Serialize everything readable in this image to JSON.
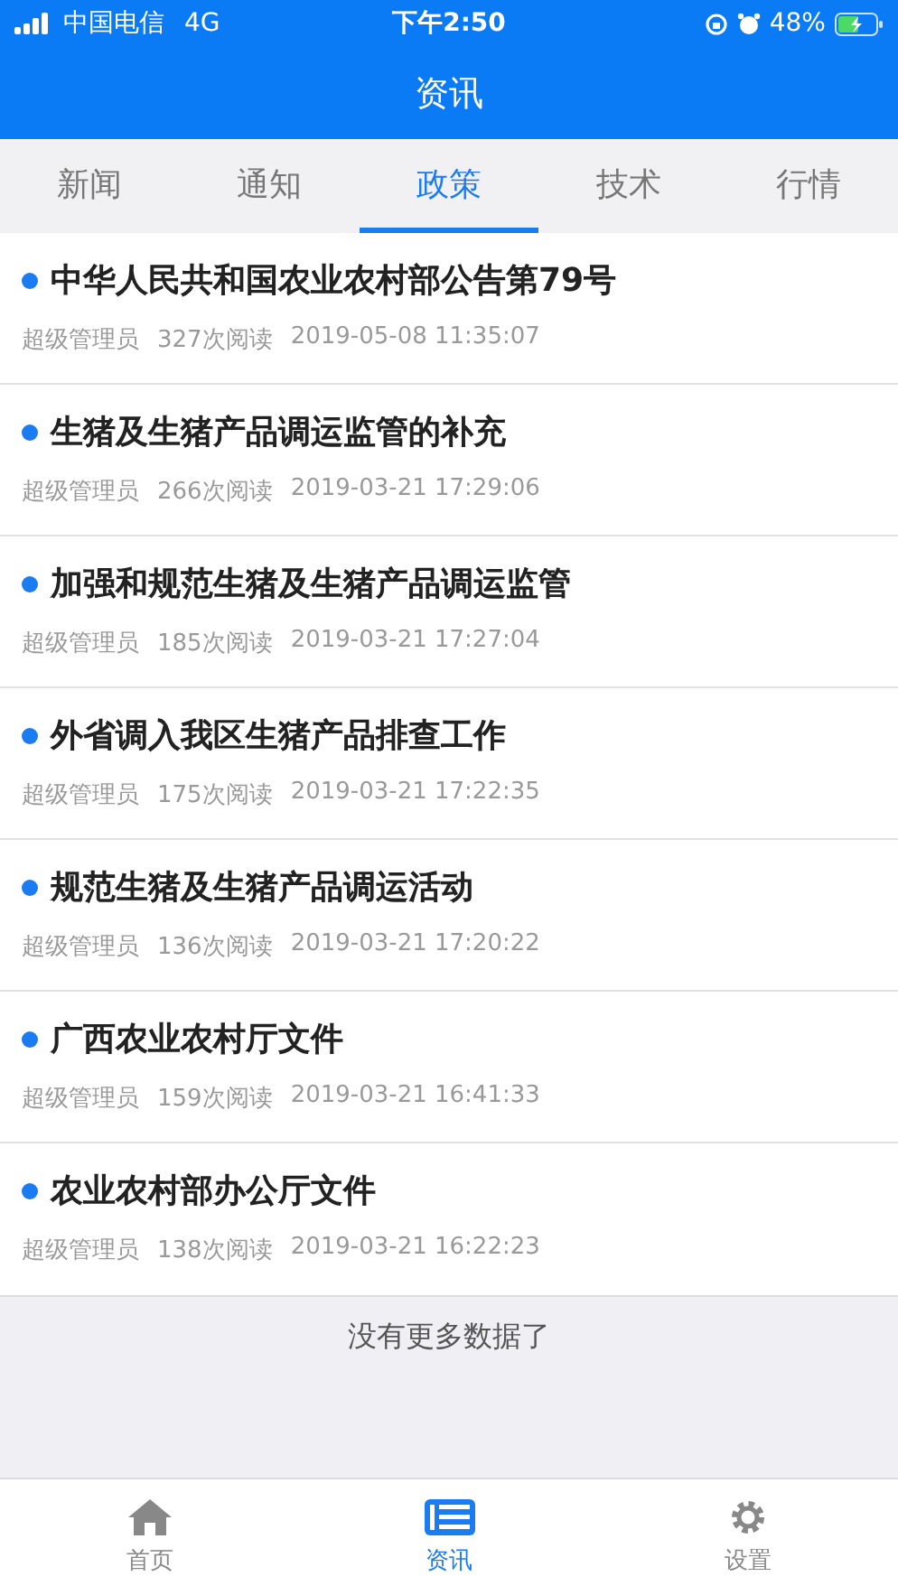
{
  "status_bar": {
    "carrier": "中国电信",
    "network": "4G",
    "time": "下午2:50",
    "battery": "48%"
  },
  "header": {
    "title": "资讯"
  },
  "tabs": [
    {
      "label": "新闻",
      "selected": false
    },
    {
      "label": "通知",
      "selected": false
    },
    {
      "label": "政策",
      "selected": true
    },
    {
      "label": "技术",
      "selected": false
    },
    {
      "label": "行情",
      "selected": false
    }
  ],
  "articles": [
    {
      "title": "中华人民共和国农业农村部公告第79号",
      "author": "超级管理员",
      "reads": "327次阅读",
      "date": "2019-05-08 11:35:07"
    },
    {
      "title": "生猪及生猪产品调运监管的补充",
      "author": "超级管理员",
      "reads": "266次阅读",
      "date": "2019-03-21 17:29:06"
    },
    {
      "title": "加强和规范生猪及生猪产品调运监管",
      "author": "超级管理员",
      "reads": "185次阅读",
      "date": "2019-03-21 17:27:04"
    },
    {
      "title": "外省调入我区生猪产品排查工作",
      "author": "超级管理员",
      "reads": "175次阅读",
      "date": "2019-03-21 17:22:35"
    },
    {
      "title": "规范生猪及生猪产品调运活动",
      "author": "超级管理员",
      "reads": "136次阅读",
      "date": "2019-03-21 17:20:22"
    },
    {
      "title": "广西农业农村厅文件",
      "author": "超级管理员",
      "reads": "159次阅读",
      "date": "2019-03-21 16:41:33"
    },
    {
      "title": "农业农村部办公厅文件",
      "author": "超级管理员",
      "reads": "138次阅读",
      "date": "2019-03-21 16:22:23"
    }
  ],
  "end_note": "没有更多数据了",
  "bottom_nav": [
    {
      "kind": "home",
      "label": "首页",
      "selected": false
    },
    {
      "kind": "news",
      "label": "资讯",
      "selected": true
    },
    {
      "kind": "settings",
      "label": "设置",
      "selected": false
    }
  ]
}
